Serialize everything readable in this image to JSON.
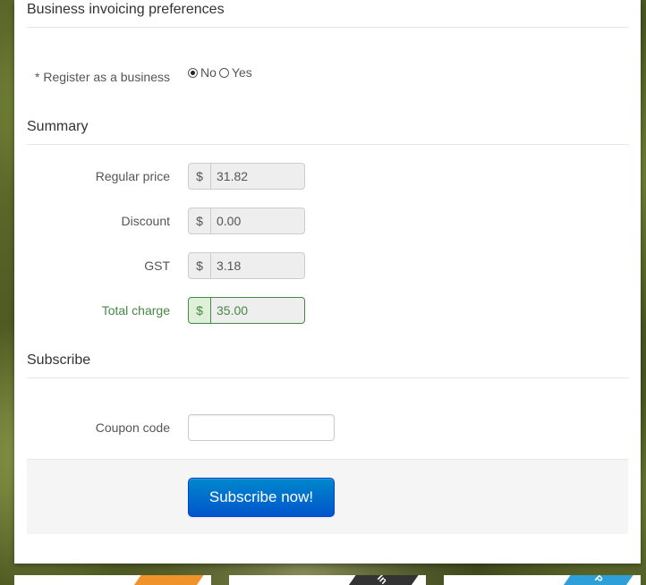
{
  "invoicing": {
    "title": "Business invoicing preferences",
    "register_label": "* Register as a business",
    "options": [
      {
        "label": "No",
        "selected": true
      },
      {
        "label": "Yes",
        "selected": false
      }
    ]
  },
  "summary": {
    "title": "Summary",
    "currency_symbol": "$",
    "rows": [
      {
        "label": "Regular price",
        "value": "31.82"
      },
      {
        "label": "Discount",
        "value": "0.00"
      },
      {
        "label": "GST",
        "value": "3.18"
      },
      {
        "label": "Total charge",
        "value": "35.00"
      }
    ]
  },
  "subscribe": {
    "title": "Subscribe",
    "coupon_label": "Coupon code",
    "coupon_value": "",
    "button_label": "Subscribe now!"
  },
  "footer_cards": [
    {
      "ribbon_color": "#f0932b",
      "ribbon_text": ""
    },
    {
      "ribbon_color": "#333333",
      "ribbon_text": "In"
    },
    {
      "ribbon_color": "#2e9fd8",
      "ribbon_text": "P"
    }
  ],
  "colors": {
    "success": "#468847",
    "primary": "#0066cc"
  }
}
